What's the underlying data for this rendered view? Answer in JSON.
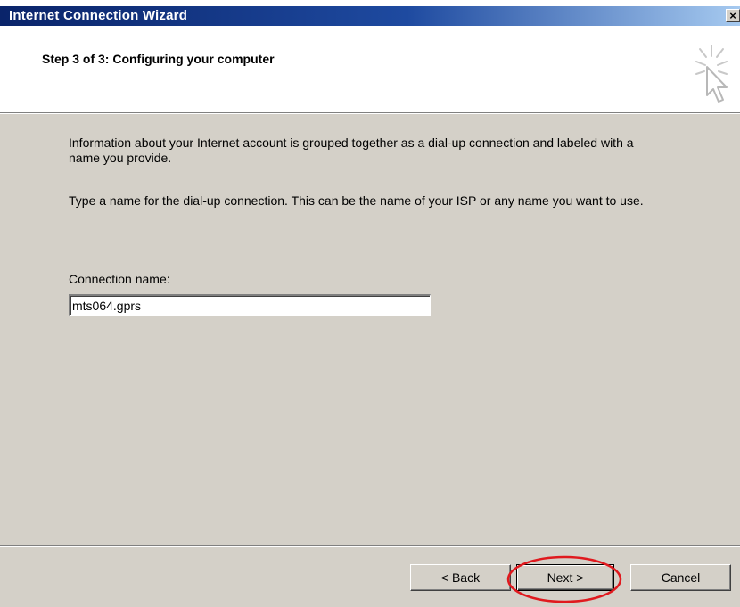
{
  "window": {
    "title": "Internet Connection Wizard",
    "close_glyph": "×"
  },
  "header": {
    "step_title": "Step 3 of 3: Configuring your computer",
    "icon": "wizard-cursor-icon"
  },
  "content": {
    "paragraph1": "Information about your Internet account is grouped together as a dial-up connection and labeled with a name you provide.",
    "paragraph2": "Type a name for the dial-up connection. This can be the name of your ISP or any name you want to use.",
    "connection_label": "Connection name:",
    "connection_value": "mts064.gprs"
  },
  "buttons": {
    "back": "< Back",
    "next": "Next >",
    "cancel": "Cancel"
  },
  "colors": {
    "titlebar": "#0a246a",
    "dialog_face": "#d4d0c8",
    "annotation": "#e0191e"
  }
}
